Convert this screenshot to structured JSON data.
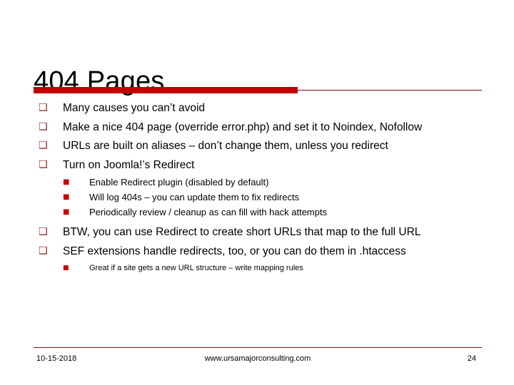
{
  "slide": {
    "title": "404 Pages",
    "accent_color": "#c00000",
    "rule_color": "#7a1113",
    "bullet_level1_color": "#8b1a1a",
    "bullet_level2_color": "#cc0000",
    "bullet_level1_glyph": "❑",
    "bullet_level2_glyph": "■"
  },
  "content": {
    "items": [
      {
        "text": "Many causes you can’t avoid"
      },
      {
        "text": "Make a nice 404 page (override error.php) and set it to Noindex, Nofollow"
      },
      {
        "text": "URLs are built on aliases – don’t change them, unless you redirect"
      },
      {
        "text": "Turn on Joomla!’s Redirect",
        "subitems": [
          "Enable Redirect plugin (disabled by default)",
          "Will log 404s – you can update them to fix redirects",
          "Periodically review / cleanup as can fill with hack attempts"
        ]
      },
      {
        "text": "BTW, you can use Redirect to create short URLs that map to the full URL"
      },
      {
        "text": "SEF extensions handle redirects, too, or you can do them in .htaccess",
        "subitems_small": [
          "Great if a site gets a new URL structure – write mapping rules"
        ]
      }
    ]
  },
  "footer": {
    "date": "10-15-2018",
    "url": "www.ursamajorconsulting.com",
    "page_number": "24"
  }
}
